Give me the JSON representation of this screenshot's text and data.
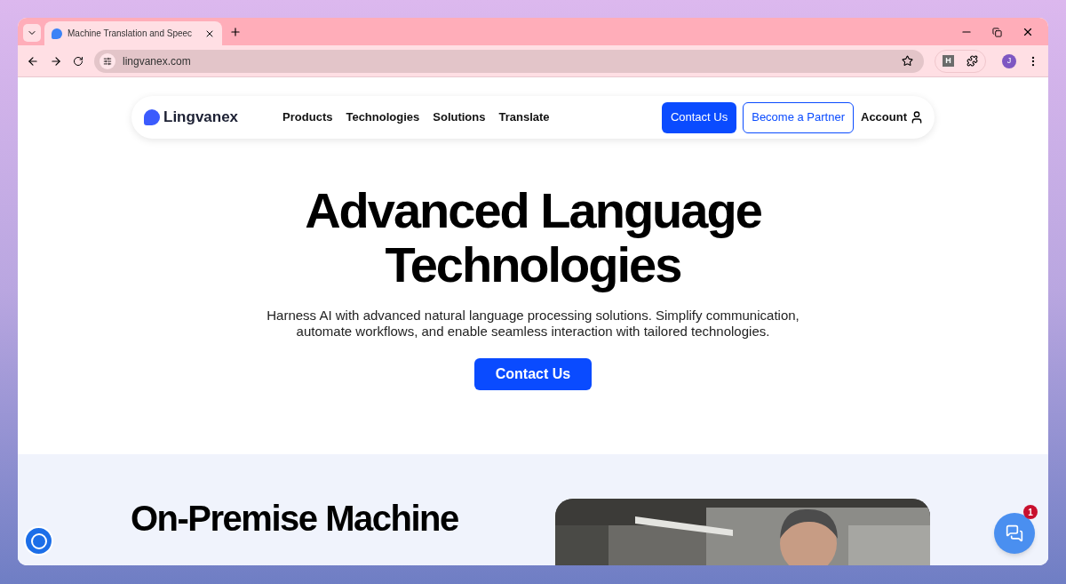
{
  "browser": {
    "tabs": [
      {
        "title": "Machine Translation and Speec",
        "selected": true
      }
    ],
    "address": "lingvanex.com",
    "profile_initial": "J",
    "extension_label": "H"
  },
  "nav": {
    "logo": "Lingvanex",
    "links": [
      "Products",
      "Technologies",
      "Solutions",
      "Translate"
    ],
    "contact": "Contact Us",
    "partner": "Become a Partner",
    "account": "Account"
  },
  "hero": {
    "title_lines": [
      "Advanced Language",
      "Technologies"
    ],
    "subtitle_lines": [
      "Harness AI with advanced natural language processing solutions. Simplify communication,",
      "automate workflows, and enable seamless interaction with tailored technologies."
    ],
    "cta": "Contact Us"
  },
  "section": {
    "title_lines": [
      "On-Premise Machine"
    ],
    "image": {
      "kind": "picture"
    }
  },
  "chat": {
    "badge": "1"
  }
}
